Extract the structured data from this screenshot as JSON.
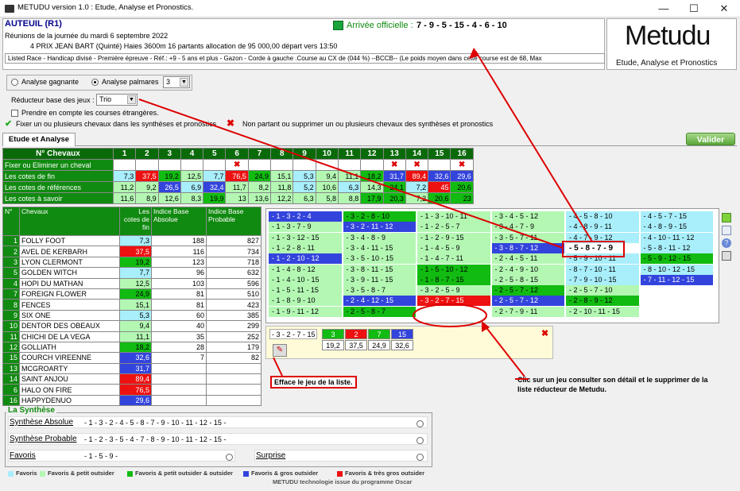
{
  "window": {
    "title": "METUDU version 1.0  : Etude, Analyse et Pronostics.",
    "min": "—",
    "max": "☐",
    "close": "✕"
  },
  "race": {
    "title": "AUTEUIL (R1)",
    "date": "Réunions de la journée du mardi 6 septembre 2022",
    "desc": "4 PRIX JEAN BART (Quinté) Haies 3600m 16 partants allocation de 95 000,00 départ vers 13:50",
    "conditions": "Listed Race - Handicap divisé - Première épreuve - Réf.: +9 - 5 ans et plus - Gazon - Corde à gauche .Course au CX de (044 %)  --BCCB--  (Le poids moyen dans cette course est de 68, Max"
  },
  "arrival": {
    "label": "Arrivée officielle :",
    "value": "7 - 9 - 5 - 15 - 4 - 6 - 10"
  },
  "logo": {
    "name": "Metudu",
    "subtitle": "Etude, Analyse et Pronostics"
  },
  "options": {
    "analyse_gagnante": "Analyse gagnante",
    "analyse_palmares": "Analyse palmares",
    "palmares_value": "3",
    "reducteur_label": "Réducteur base des jeux :",
    "reducteur_value": "Trio",
    "etrangeres": "Prendre en compte les courses étrangères.",
    "fixer": "Fixer un ou plusieurs chevaux dans les synthèses et pronostics",
    "non_partant": "Non partant ou supprimer un ou plusieurs chevaux des synthèses et pronostics"
  },
  "tabs": {
    "etude": "Etude et Analyse",
    "valider": "Valider"
  },
  "grid": {
    "header_label": "N° Chevaux",
    "numbers": [
      "1",
      "2",
      "3",
      "4",
      "5",
      "6",
      "7",
      "8",
      "9",
      "10",
      "11",
      "12",
      "13",
      "14",
      "15",
      "16"
    ],
    "fix_label": "Fixer ou Eliminer un cheval",
    "removed": [
      6,
      13,
      14,
      16
    ],
    "rows": [
      {
        "label": "Les cotes de fin",
        "values": [
          "7,3",
          "37,5",
          "19,2",
          "12,5",
          "7,7",
          "76,5",
          "24,9",
          "15,1",
          "5,3",
          "9,4",
          "11,1",
          "18,2",
          "31,7",
          "89,4",
          "32,6",
          "29,6"
        ],
        "colors": [
          "#a8eefb",
          "#ee1111",
          "#11bb11",
          "#b3f7b3",
          "#a8eefb",
          "#ee1111",
          "#11bb11",
          "#b3f7b3",
          "#a8eefb",
          "#b3f7b3",
          "#b3f7b3",
          "#11bb11",
          "#3344dd",
          "#ee1111",
          "#3344dd",
          "#3344dd"
        ]
      },
      {
        "label": "Les cotes de références",
        "values": [
          "11,2",
          "9,2",
          "26,5",
          "6,9",
          "32,4",
          "11,7",
          "8,2",
          "11,8",
          "5,2",
          "10,6",
          "6,3",
          "14,3",
          "24,1",
          "7,2",
          "45",
          "20,6"
        ],
        "colors": [
          "#b3f7b3",
          "#b3f7b3",
          "#3344dd",
          "#a8eefb",
          "#3344dd",
          "#b3f7b3",
          "#b3f7b3",
          "#b3f7b3",
          "#a8eefb",
          "#b3f7b3",
          "#a8eefb",
          "#b3f7b3",
          "#11bb11",
          "#a8eefb",
          "#ee1111",
          "#11bb11"
        ]
      },
      {
        "label": "Les cotes à savoir",
        "values": [
          "11,6",
          "8,9",
          "12,6",
          "8,3",
          "19,9",
          "13",
          "13,6",
          "12,2",
          "6,3",
          "5,8",
          "8,8",
          "17,9",
          "20,3",
          "7,2",
          "20,6",
          "23"
        ],
        "colors": [
          "#b3f7b3",
          "#b3f7b3",
          "#b3f7b3",
          "#b3f7b3",
          "#11bb11",
          "#b3f7b3",
          "#b3f7b3",
          "#b3f7b3",
          "#b3f7b3",
          "#b3f7b3",
          "#b3f7b3",
          "#11bb11",
          "#11bb11",
          "#b3f7b3",
          "#11bb11",
          "#11bb11"
        ]
      }
    ]
  },
  "horses": {
    "headers": [
      "N°",
      "Chevaux",
      "Les cotes de fin",
      "Indice Base Absolue",
      "Indice Base Probable"
    ],
    "rows": [
      {
        "n": "1",
        "name": "FOLLY FOOT",
        "cote": "7,3",
        "abs": "188",
        "prob": "827",
        "color": "#a8eefb"
      },
      {
        "n": "2",
        "name": "AVEL DE KERBARH",
        "cote": "37,5",
        "abs": "116",
        "prob": "734",
        "color": "#ee1111"
      },
      {
        "n": "3",
        "name": "LYON CLERMONT",
        "cote": "19,2",
        "abs": "123",
        "prob": "718",
        "color": "#11bb11"
      },
      {
        "n": "5",
        "name": "GOLDEN WITCH",
        "cote": "7,7",
        "abs": "96",
        "prob": "632",
        "color": "#a8eefb"
      },
      {
        "n": "4",
        "name": "HOPI DU MATHAN",
        "cote": "12,5",
        "abs": "103",
        "prob": "596",
        "color": "#b3f7b3"
      },
      {
        "n": "7",
        "name": "FOREIGN FLOWER",
        "cote": "24,9",
        "abs": "81",
        "prob": "510",
        "color": "#11bb11"
      },
      {
        "n": "8",
        "name": "FENCES",
        "cote": "15,1",
        "abs": "81",
        "prob": "423",
        "color": "#b3f7b3"
      },
      {
        "n": "9",
        "name": "SIX ONE",
        "cote": "5,3",
        "abs": "60",
        "prob": "385",
        "color": "#a8eefb"
      },
      {
        "n": "10",
        "name": "DENTOR DES OBEAUX",
        "cote": "9,4",
        "abs": "40",
        "prob": "299",
        "color": "#b3f7b3"
      },
      {
        "n": "11",
        "name": "CHICHI DE LA VEGA",
        "cote": "11,1",
        "abs": "35",
        "prob": "252",
        "color": "#b3f7b3"
      },
      {
        "n": "12",
        "name": "GOLLIATH",
        "cote": "18,2",
        "abs": "28",
        "prob": "179",
        "color": "#11bb11"
      },
      {
        "n": "15",
        "name": "COURCH VIREENNE",
        "cote": "32,6",
        "abs": "7",
        "prob": "82",
        "color": "#3344dd"
      },
      {
        "n": "13",
        "name": "MCGROARTY",
        "cote": "31,7",
        "abs": "",
        "prob": "",
        "color": "#3344dd"
      },
      {
        "n": "14",
        "name": "SAINT ANJOU",
        "cote": "89,4",
        "abs": "",
        "prob": "",
        "color": "#ee1111"
      },
      {
        "n": "6",
        "name": "HALO ON FIRE",
        "cote": "76,5",
        "abs": "",
        "prob": "",
        "color": "#ee1111"
      },
      {
        "n": "16",
        "name": "HAPPYDENUO",
        "cote": "29,6",
        "abs": "",
        "prob": "",
        "color": "#3344dd"
      }
    ]
  },
  "combos": [
    [
      [
        "- 1 - 3 - 2 - 4",
        "#3344dd"
      ],
      [
        "- 1 - 3 - 7 - 9",
        "#b3f7b3"
      ],
      [
        "- 1 - 3 - 12 - 15",
        "#b3f7b3"
      ],
      [
        "- 1 - 2 - 8 - 11",
        "#b3f7b3"
      ],
      [
        "- 1 - 2 - 10 - 12",
        "#3344dd"
      ],
      [
        "- 1 - 4 - 8 - 12",
        "#b3f7b3"
      ],
      [
        "- 1 - 4 - 10 - 15",
        "#b3f7b3"
      ],
      [
        "- 1 - 5 - 11 - 15",
        "#b3f7b3"
      ],
      [
        "- 1 - 8 - 9 - 10",
        "#b3f7b3"
      ],
      [
        "- 1 - 9 - 11 - 12",
        "#b3f7b3"
      ]
    ],
    [
      [
        "- 3 - 2 - 8 - 10",
        "#11bb11"
      ],
      [
        "- 3 - 2 - 11 - 12",
        "#3344dd"
      ],
      [
        "- 3 - 4 - 8 - 9",
        "#b3f7b3"
      ],
      [
        "- 3 - 4 - 11 - 15",
        "#b3f7b3"
      ],
      [
        "- 3 - 5 - 10 - 15",
        "#b3f7b3"
      ],
      [
        "- 3 - 8 - 11 - 15",
        "#b3f7b3"
      ],
      [
        "- 3 - 9 - 11 - 15",
        "#b3f7b3"
      ],
      [
        "- 3 - 5 - 8 - 7",
        "#b3f7b3"
      ],
      [
        "- 2 - 4 - 12 - 15",
        "#3344dd"
      ],
      [
        "- 2 - 5 - 8 - 7",
        "#11bb11"
      ]
    ],
    [
      [
        "- 1 - 3 - 10 - 11",
        "#b3f7b3"
      ],
      [
        "- 1 - 2 - 5 - 7",
        "#b3f7b3"
      ],
      [
        "- 1 - 2 - 9 - 15",
        "#b3f7b3"
      ],
      [
        "- 1 - 4 - 5 - 9",
        "#b3f7b3"
      ],
      [
        "- 1 - 4 - 7 - 11",
        "#b3f7b3"
      ],
      [
        "- 1 - 5 - 10 - 12",
        "#11bb11"
      ],
      [
        "- 1 - 8 - 7 - 15",
        "#11bb11"
      ],
      [
        "- 3 - 2 - 5 - 9",
        "#b3f7b3"
      ],
      [
        "- 3 - 2 - 7 - 15",
        "#ee1111"
      ],
      [
        "",
        "#ffffff"
      ]
    ],
    [
      [
        "- 3 - 4 - 5 - 12",
        "#b3f7b3"
      ],
      [
        "- 3 - 4 - 7 - 9",
        "#b3f7b3"
      ],
      [
        "- 3 - 5 - 7 - 11",
        "#b3f7b3"
      ],
      [
        "- 3 - 8 - 7 - 12",
        "#3344dd"
      ],
      [
        "- 2 - 4 - 5 - 11",
        "#b3f7b3"
      ],
      [
        "- 2 - 4 - 9 - 10",
        "#b3f7b3"
      ],
      [
        "- 2 - 5 - 8 - 15",
        "#b3f7b3"
      ],
      [
        "- 2 - 5 - 7 - 12",
        "#11bb11"
      ],
      [
        "- 2 - 5 - 7 - 12",
        "#3344dd"
      ],
      [
        "- 2 - 7 - 9 - 11",
        "#b3f7b3"
      ]
    ],
    [
      [
        "- 4 - 5 - 8 - 10",
        "#a8eefb"
      ],
      [
        "- 4 - 8 - 9 - 11",
        "#a8eefb"
      ],
      [
        "- 4 - 7 - 9 - 12",
        "#a8eefb"
      ],
      [
        "- 5 - 8 - 7 - 9",
        "#ffffff"
      ],
      [
        "- 5 - 9 - 10 - 11",
        "#a8eefb"
      ],
      [
        "- 8 - 7 - 10 - 11",
        "#a8eefb"
      ],
      [
        "- 7 - 9 - 10 - 15",
        "#a8eefb"
      ],
      [
        "- 2 - 5 - 7 - 10",
        "#b3f7b3"
      ],
      [
        "- 2 - 8 - 9 - 12",
        "#11bb11"
      ],
      [
        "- 2 - 10 - 11 - 15",
        "#b3f7b3"
      ]
    ],
    [
      [
        "- 4 - 5 - 7 - 15",
        "#a8eefb"
      ],
      [
        "- 4 - 8 - 9 - 15",
        "#a8eefb"
      ],
      [
        "- 4 - 10 - 11 - 12",
        "#a8eefb"
      ],
      [
        "- 5 - 8 - 11 - 12",
        "#a8eefb"
      ],
      [
        "- 5 - 9 - 12 - 15",
        "#11bb11"
      ],
      [
        "- 8 - 10 - 12 - 15",
        "#a8eefb"
      ],
      [
        "- 7 - 11 - 12 - 15",
        "#3344dd"
      ],
      [
        "",
        "#ffffff"
      ],
      [
        "",
        "#ffffff"
      ],
      [
        "",
        "#ffffff"
      ]
    ]
  ],
  "detail": {
    "combo": "- 3 - 2 - 7 - 15",
    "numbers": [
      "3",
      "2",
      "7",
      "15"
    ],
    "num_colors": [
      "#11bb11",
      "#ee1111",
      "#11bb11",
      "#3344dd"
    ],
    "cotes": [
      "19,2",
      "37,5",
      "24,9",
      "32,6"
    ]
  },
  "callouts": {
    "efface": "Efface le jeu de la liste.",
    "clic": "Clic sur un jeu consulter son détail et le supprimer de la liste réducteur de Metudu."
  },
  "synthese": {
    "label": "La Synthèse",
    "absolue_label": "Synthèse Absolue",
    "absolue_value": "- 1 - 3 - 2 - 4 - 5 - 8 - 7 - 9 - 10 - 11 - 12 - 15 -",
    "probable_label": "Synthèse Probable",
    "probable_value": "- 1 - 2 - 3 - 5 - 4 - 7 - 8 - 9 - 10 - 11 - 12 - 15 -",
    "favoris_label": "Favoris",
    "favoris_value": "- 1 - 5 - 9 -",
    "surprise_label": "Surprise",
    "surprise_value": ""
  },
  "legend": [
    {
      "label": "Favoris",
      "color": "#a8eefb"
    },
    {
      "label": "Favoris & petit outsider",
      "color": "#b3f7b3"
    },
    {
      "label": "Favoris & petit outsider & outsider",
      "color": "#11bb11"
    },
    {
      "label": "Favoris & gros outsider",
      "color": "#3344dd"
    },
    {
      "label": "Favoris & très gros outsider",
      "color": "#ee1111"
    }
  ],
  "footer": "METUDU technologie issue du programme Oscar"
}
